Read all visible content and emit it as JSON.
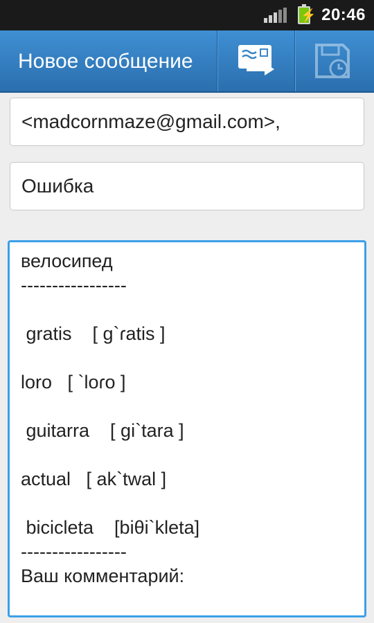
{
  "status_bar": {
    "time": "20:46",
    "signal_icon": "signal-bars-icon",
    "battery_icon": "battery-charging-icon"
  },
  "action_bar": {
    "title": "Новое сообщение",
    "send_icon": "send-message-icon",
    "save_draft_icon": "save-draft-icon",
    "background_color": "#3a86c8"
  },
  "compose": {
    "to": "<madcornmaze@gmail.com>,",
    "subject": "Ошибка",
    "body_lines": [
      "велосипед",
      "-----------------",
      "",
      " gratis    [ g`ɾatis ]",
      "",
      "loro   [ `loɾo ]",
      "",
      " guitarra    [ gi`tara ]",
      "",
      "actual   [ ak`twal ]",
      "",
      " bicicleta    [biθi`kleta]",
      "-----------------",
      "Ваш комментарий:"
    ],
    "focus_color": "#3aa0e8"
  }
}
